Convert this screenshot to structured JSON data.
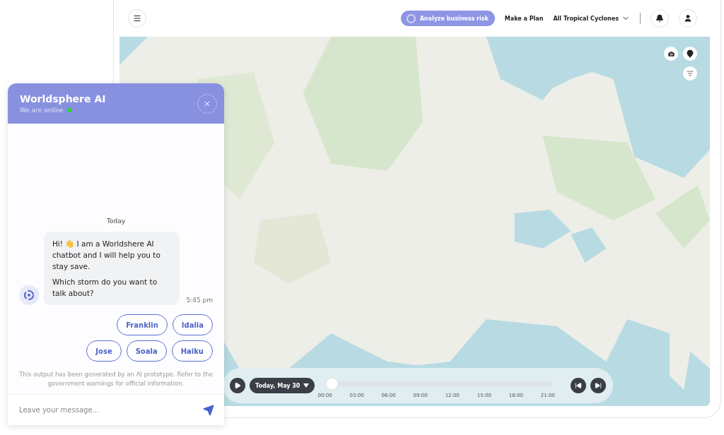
{
  "topbar": {
    "analyze_button": "Analyze business risk",
    "plan_link": "Make a Plan",
    "storm_filter": "All Tropical Cyclones"
  },
  "timeline": {
    "date": "Today, May 30",
    "level": 0,
    "ticks": [
      "00:00",
      "03:00",
      "06:00",
      "09:00",
      "12:00",
      "15:00",
      "18:00",
      "21:00"
    ]
  },
  "chat": {
    "title": "Worldsphere AI",
    "status": "We are online",
    "online": true,
    "day": "Today",
    "message": {
      "paragraphs": [
        "Hi! 👋 I am a Worldshere AI chatbot and I will help you to stay save.",
        "Which storm do you want to talk about?"
      ],
      "time": "5:45 pm"
    },
    "suggestions": [
      [
        "Franklin",
        "Idalia"
      ],
      [
        "Jose",
        "Soala",
        "Haiku"
      ]
    ],
    "disclaimer": "This output has been generated by an AI prototype. Refer to the government warnings for official information.",
    "input": {
      "placeholder": "Leave your message..."
    }
  }
}
